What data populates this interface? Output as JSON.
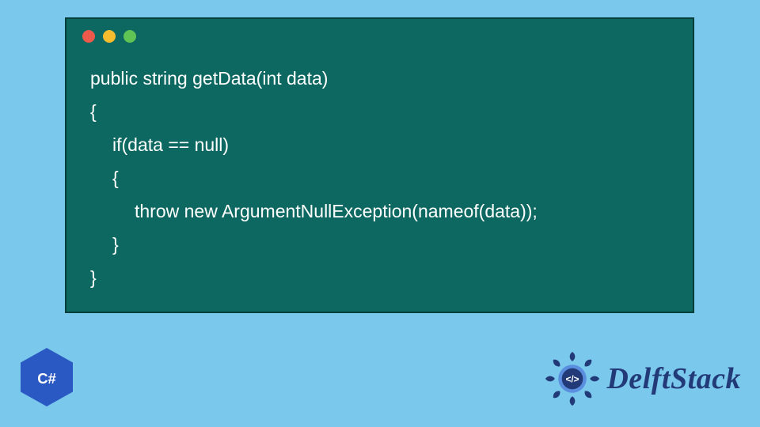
{
  "window": {
    "traffic_lights": [
      "#ed594a",
      "#f7bd2e",
      "#5fc454"
    ]
  },
  "code": {
    "lines": [
      {
        "indent": 0,
        "text": "public string getData(int data)"
      },
      {
        "indent": 0,
        "text": "{"
      },
      {
        "indent": 1,
        "text": "if(data == null)"
      },
      {
        "indent": 1,
        "text": "{"
      },
      {
        "indent": 2,
        "text": "throw new ArgumentNullException(nameof(data));"
      },
      {
        "indent": 1,
        "text": "}"
      },
      {
        "indent": 0,
        "text": "}"
      }
    ]
  },
  "badges": {
    "csharp": {
      "label": "C#"
    },
    "delftstack": {
      "label": "DelftStack",
      "code_tag": "</>"
    }
  },
  "colors": {
    "page_bg": "#7ac8eb",
    "window_bg": "#0e6862",
    "window_border": "#043f3c",
    "code_fg": "#ffffff",
    "cs_badge": "#2b59c3",
    "delft_primary": "#223a77",
    "delft_accent": "#5a8fe0"
  }
}
